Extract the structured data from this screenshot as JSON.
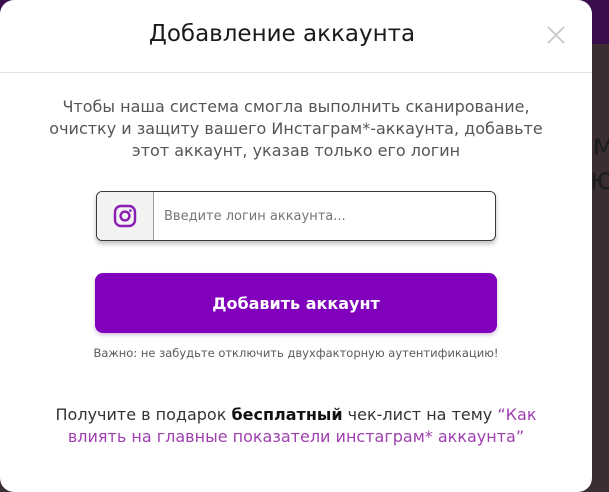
{
  "modal": {
    "title": "Добавление аккаунта",
    "description": "Чтобы наша система смогла выполнить сканирование, очистку и защиту вашего Инстаграм*-аккаунта, добавьте этот аккаунт, указав только его логин",
    "login_placeholder": "Введите логин аккаунта...",
    "login_value": "",
    "add_button_label": "Добавить аккаунт",
    "notice": "Важно: не забудьте отключить двухфакторную аутентификацию!",
    "gift_prefix": "Получите в подарок ",
    "gift_bold": "бесплатный",
    "gift_middle": " чек-лист на тему ",
    "gift_link": "“Как влиять на главные показатели инстаграм* аккаунта”"
  },
  "backdrop": {
    "partial_text_1": "см",
    "partial_text_2": "ю"
  },
  "icons": {
    "close": "close-icon",
    "instagram": "instagram-icon"
  },
  "colors": {
    "accent": "#8000bc",
    "link": "#9f3fb0",
    "instagram_icon": "#8b1fb4",
    "backdrop_top": "#3a0e4c"
  }
}
